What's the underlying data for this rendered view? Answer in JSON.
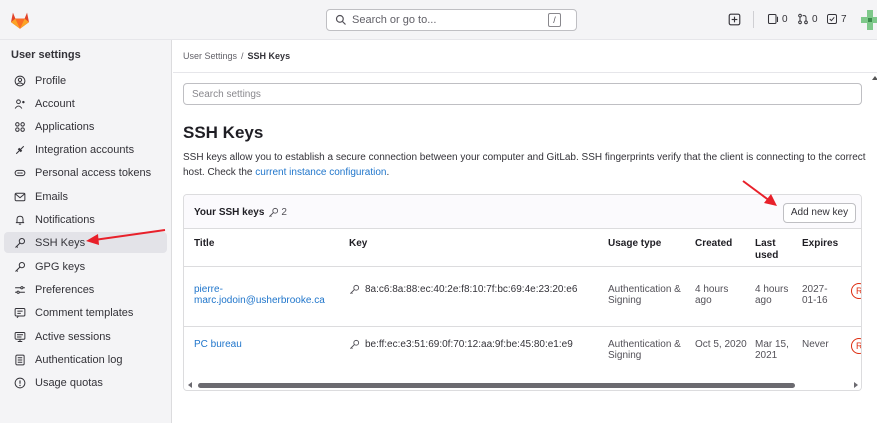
{
  "topbar": {
    "search_placeholder": "Search or go to...",
    "search_shortcut": "/",
    "issues_count": "0",
    "merge_requests_count": "0",
    "todos_count": "7"
  },
  "sidebar": {
    "title": "User settings",
    "items": [
      {
        "label": "Profile",
        "icon": "profile-icon"
      },
      {
        "label": "Account",
        "icon": "account-icon"
      },
      {
        "label": "Applications",
        "icon": "applications-icon"
      },
      {
        "label": "Integration accounts",
        "icon": "integration-icon"
      },
      {
        "label": "Personal access tokens",
        "icon": "token-icon"
      },
      {
        "label": "Emails",
        "icon": "mail-icon"
      },
      {
        "label": "Notifications",
        "icon": "bell-icon"
      },
      {
        "label": "SSH Keys",
        "icon": "key-icon",
        "active": true
      },
      {
        "label": "GPG keys",
        "icon": "key-icon"
      },
      {
        "label": "Preferences",
        "icon": "preferences-icon"
      },
      {
        "label": "Comment templates",
        "icon": "comment-icon"
      },
      {
        "label": "Active sessions",
        "icon": "monitor-icon"
      },
      {
        "label": "Authentication log",
        "icon": "log-icon"
      },
      {
        "label": "Usage quotas",
        "icon": "quota-icon"
      }
    ]
  },
  "breadcrumb": {
    "parent": "User Settings",
    "separator": "/",
    "current": "SSH Keys"
  },
  "search_settings_placeholder": "Search settings",
  "page": {
    "title": "SSH Keys",
    "description_before": "SSH keys allow you to establish a secure connection between your computer and GitLab. SSH fingerprints verify that the client is connecting to the correct host. Check the ",
    "description_link": "current instance configuration",
    "description_after": "."
  },
  "keys_card": {
    "title": "Your SSH keys",
    "count": "2",
    "add_button": "Add new key",
    "columns": [
      "Title",
      "Key",
      "Usage type",
      "Created",
      "Last used",
      "Expires"
    ],
    "rows": [
      {
        "title": "pierre-marc.jodoin@usherbrooke.ca",
        "key": "8a:c6:8a:88:ec:40:2e:f8:10:7f:bc:69:4e:23:20:e6",
        "usage": "Authentication & Signing",
        "created": "4 hours ago",
        "last_used": "4 hours ago",
        "expires": "2027-01-16",
        "action": "R"
      },
      {
        "title": "PC bureau",
        "key": "be:ff:ec:e3:51:69:0f:70:12:aa:9f:be:45:80:e1:e9",
        "usage": "Authentication & Signing",
        "created": "Oct 5, 2020",
        "last_used": "Mar 15, 2021",
        "expires": "Never",
        "action": "R"
      }
    ]
  },
  "colors": {
    "accent_link": "#1f75cb",
    "danger": "#dd2b0e",
    "annotation_arrow": "#e8202a"
  }
}
